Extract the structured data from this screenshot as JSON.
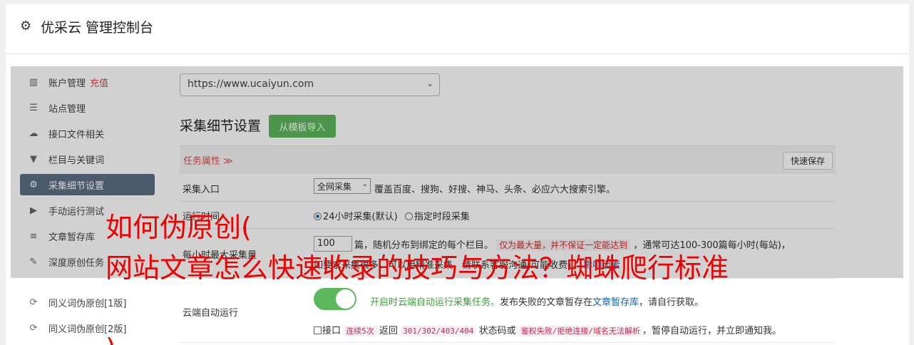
{
  "header": {
    "title": "优采云 管理控制台",
    "icon": "gear-icon"
  },
  "sidebar": {
    "items": [
      {
        "label": "账户管理",
        "extra": "充值",
        "icon": "bar-chart-icon",
        "glyph": "▥"
      },
      {
        "label": "站点管理",
        "icon": "server-icon",
        "glyph": "☰"
      },
      {
        "label": "接口文件相关",
        "icon": "cloud-upload-icon",
        "glyph": "☁"
      },
      {
        "label": "栏目与关键词",
        "icon": "filter-icon",
        "glyph": "▼"
      },
      {
        "label": "采集细节设置",
        "icon": "cogs-icon",
        "glyph": "⚙",
        "active": true
      },
      {
        "label": "手动运行测试",
        "icon": "play-icon",
        "glyph": "▶"
      },
      {
        "label": "文章暂存库",
        "icon": "database-icon",
        "glyph": "≡"
      },
      {
        "label": "深度原创任务",
        "icon": "edit-icon",
        "glyph": "✎"
      },
      {
        "label": "同义词伪原创[1版]",
        "icon": "refresh-icon",
        "glyph": "⟳"
      },
      {
        "label": "同义词伪原创[2版]",
        "icon": "refresh-icon",
        "glyph": "⟳"
      }
    ]
  },
  "main": {
    "site_select": "https://www.ucaiyun.com",
    "section_title": "采集细节设置",
    "import_button": "从模板导入",
    "task_attr": "任务属性 ≫",
    "quick_save": "快速保存",
    "rows": {
      "entry": {
        "label": "采集入口",
        "select": "全网采集",
        "desc": "覆盖百度、搜狗、好搜、神马、头条、必应六大搜索引擎。"
      },
      "time": {
        "label": "运行时间",
        "opt1": "24小时采集(默认)",
        "opt2": "指定时段采集"
      },
      "max": {
        "label": "每小时最大采集量",
        "value": "100",
        "text1": "篇，随机分布到绑定的每个栏目。",
        "warn": "仅为最大量，并不保证一定能达到",
        "text2": "，通常可达100-300篇每小时(每站)，",
        "line2": "如要求采集很多，可以用精准采集，请联系客服沟通(可能收费)。",
        "link": "影响因素"
      },
      "cloud": {
        "label": "云端自动运行",
        "desc1": "开启时云端自动运行采集任务。",
        "desc2": "发布失败的文章暂存在",
        "link": "文章暂存库",
        "desc3": "，请自行获取。",
        "chk_label": "接口",
        "code1": "连续5次",
        "t1": "返回",
        "code2": "301/302/403/404",
        "t2": "状态码或",
        "code3": "鉴权失败/拒绝连接/域名无法解析",
        "t3": "，暂停自动运行，并立即通知我。"
      }
    }
  },
  "overlay_text": {
    "line1": "如何伪原创(",
    "line2": "网站文章怎么快速收录的技巧与方法？蜘蛛爬行标准",
    "line3": ")"
  }
}
